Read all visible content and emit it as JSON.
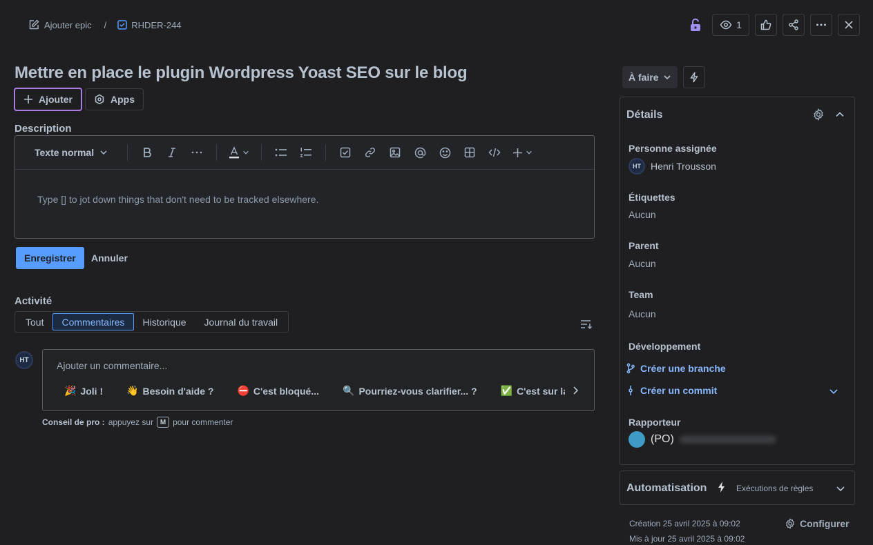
{
  "breadcrumb": {
    "parent_label": "Ajouter epic",
    "separator": "/",
    "issue_key": "RHDER-244"
  },
  "header_actions": {
    "watch_count": "1"
  },
  "issue": {
    "title": "Mettre en place le plugin Wordpress Yoast SEO sur le blog"
  },
  "quick_actions": {
    "add_label": "Ajouter",
    "apps_label": "Apps"
  },
  "description": {
    "heading": "Description",
    "text_style": "Texte normal",
    "placeholder": "Type [] to jot down things that don't need to be tracked elsewhere.",
    "save_label": "Enregistrer",
    "cancel_label": "Annuler"
  },
  "activity": {
    "heading": "Activité",
    "tabs": [
      {
        "label": "Tout"
      },
      {
        "label": "Commentaires"
      },
      {
        "label": "Historique"
      },
      {
        "label": "Journal du travail"
      }
    ],
    "avatar_initials": "HT",
    "comment_placeholder": "Ajouter un commentaire...",
    "chips": [
      {
        "emoji": "🎉",
        "label": "Joli !"
      },
      {
        "emoji": "👋",
        "label": "Besoin d'aide ?"
      },
      {
        "emoji": "⛔",
        "label": "C'est bloqué..."
      },
      {
        "emoji": "🔍",
        "label": "Pourriez-vous clarifier... ?"
      },
      {
        "emoji": "✅",
        "label": "C'est sur la bonne voie"
      }
    ],
    "tip_bold": "Conseil de pro :",
    "tip_text": "appuyez sur",
    "tip_key": "M",
    "tip_suffix": "pour commenter"
  },
  "status": {
    "label": "À faire"
  },
  "details": {
    "heading": "Détails",
    "assignee_label": "Personne assignée",
    "assignee_initials": "HT",
    "assignee_name": "Henri Trousson",
    "labels_label": "Étiquettes",
    "labels_value": "Aucun",
    "parent_label": "Parent",
    "parent_value": "Aucun",
    "team_label": "Team",
    "team_value": "Aucun",
    "dev_label": "Développement",
    "create_branch": "Créer une branche",
    "create_commit": "Créer un commit",
    "reporter_label": "Rapporteur",
    "reporter_name": "(PO)"
  },
  "automation": {
    "heading": "Automatisation",
    "rules_label": "Exécutions de règles"
  },
  "footer": {
    "created": "Création 25 avril 2025 à 09:02",
    "updated": "Mis à jour 25 avril 2025 à 09:02",
    "configure_label": "Configurer"
  },
  "colors": {
    "background": "#1f1f21",
    "accent": "#579dff",
    "link": "#85b8ff",
    "lock": "#9f8fef"
  }
}
